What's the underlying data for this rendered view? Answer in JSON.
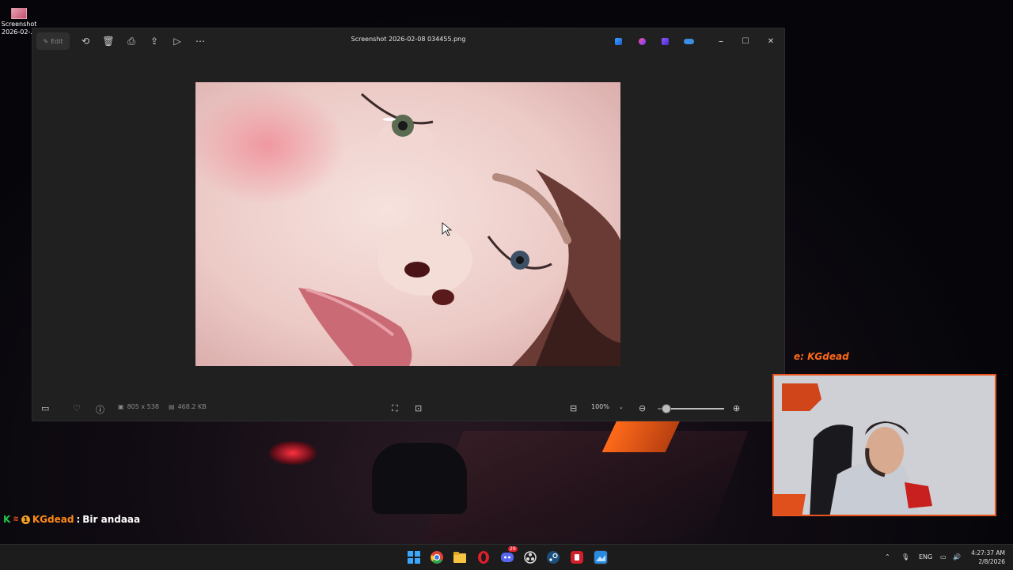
{
  "desktop": {
    "icon_label": "Screenshot 2026-02-..."
  },
  "photos_window": {
    "toolbar": {
      "edit_label": "Edit",
      "rotate_icon": "rotate-icon",
      "delete_icon": "trash-icon",
      "print_icon": "print-icon",
      "share_icon": "share-icon",
      "slideshow_icon": "slideshow-icon",
      "more_icon": "more-icon"
    },
    "title": "Screenshot 2026-02-08 034455.png",
    "app_icons": [
      "designer-icon",
      "clipchamp-icon",
      "copilot-icon",
      "onedrive-icon"
    ],
    "window_controls": {
      "minimize": "–",
      "maximize": "☐",
      "close": "✕"
    },
    "statusbar": {
      "dimensions": "805 x 538",
      "file_size": "468.2 KB",
      "zoom_value": "100%",
      "zoom_level": 0.12
    }
  },
  "stream_overlay": {
    "cam_label": "e:  KGdead",
    "chat_user": "KGdead",
    "chat_sep": ":",
    "chat_message": "Bir andaaa"
  },
  "taskbar": {
    "apps": [
      "windows-start-icon",
      "chrome-icon",
      "file-explorer-icon",
      "opera-icon",
      "discord-icon",
      "obs-icon",
      "steam-icon",
      "app-red-icon",
      "photos-icon"
    ],
    "discord_badge": "29",
    "tray": {
      "language": "ENG"
    },
    "clock": {
      "time": "4:27:37 AM",
      "date": "2/8/2026"
    }
  },
  "colors": {
    "accent_orange": "#ff6a1a",
    "window_bg": "#202020",
    "taskbar_bg": "#1c1c1c"
  }
}
